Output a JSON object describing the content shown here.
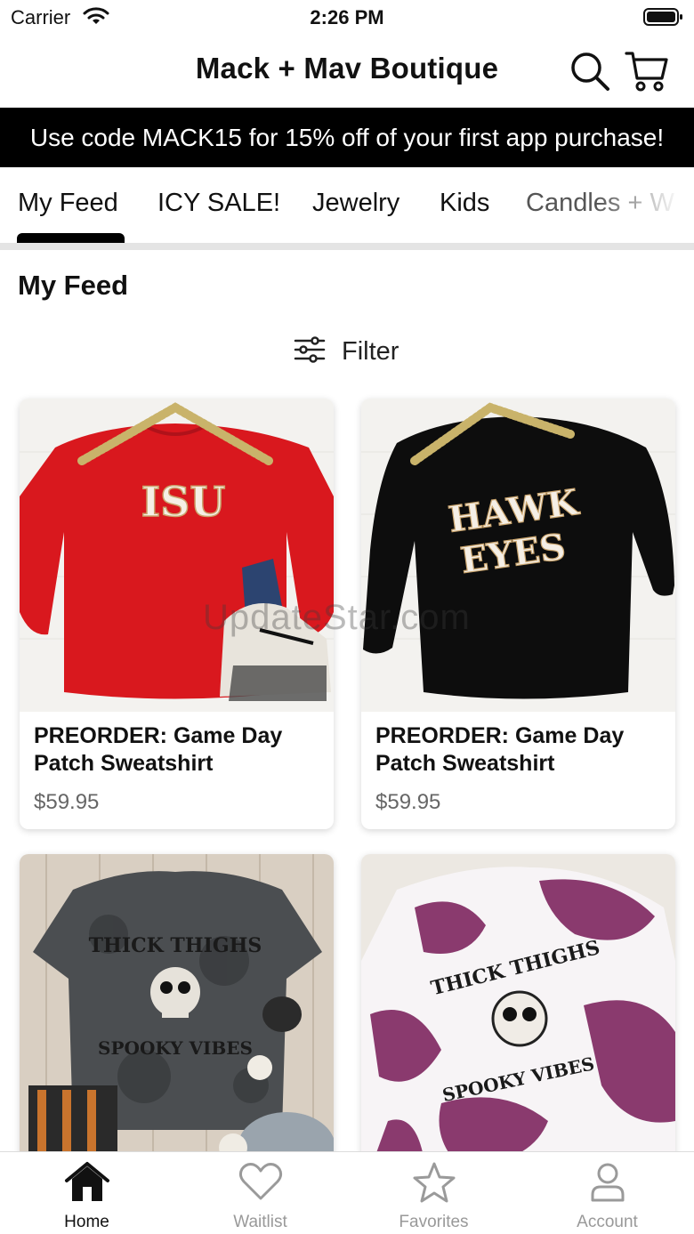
{
  "status_bar": {
    "carrier": "Carrier",
    "time": "2:26 PM"
  },
  "header": {
    "title": "Mack + Mav Boutique"
  },
  "promo": {
    "text": "Use code MACK15 for 15% off of your first app purchase!"
  },
  "tabs": [
    {
      "label": "My Feed",
      "active": true
    },
    {
      "label": "ICY SALE!"
    },
    {
      "label": "Jewelry"
    },
    {
      "label": "Kids"
    },
    {
      "label": "Candles + W"
    }
  ],
  "feed": {
    "title": "My Feed",
    "filter_label": "Filter",
    "products": [
      {
        "name": "PREORDER: Game Day Patch Sweatshirt",
        "price": "$59.95",
        "print": "ISU",
        "color": "#d9181e"
      },
      {
        "name": "PREORDER: Game Day Patch Sweatshirt",
        "price": "$59.95",
        "print_line1": "HAWK",
        "print_line2": "EYES",
        "color": "#0d0d0d"
      },
      {
        "print_line1": "THICK THIGHS",
        "print_line2": "SPOOKY VIBES",
        "color": "#3c3f41"
      },
      {
        "print_line1": "THICK THIGHS",
        "print_line2": "SPOOKY VIBES",
        "color": "#8a3a6e"
      }
    ]
  },
  "watermark": "UpdateStar.com",
  "tabbar": [
    {
      "label": "Home",
      "icon": "home-icon",
      "active": true
    },
    {
      "label": "Waitlist",
      "icon": "heart-icon"
    },
    {
      "label": "Favorites",
      "icon": "star-icon"
    },
    {
      "label": "Account",
      "icon": "person-icon"
    }
  ]
}
